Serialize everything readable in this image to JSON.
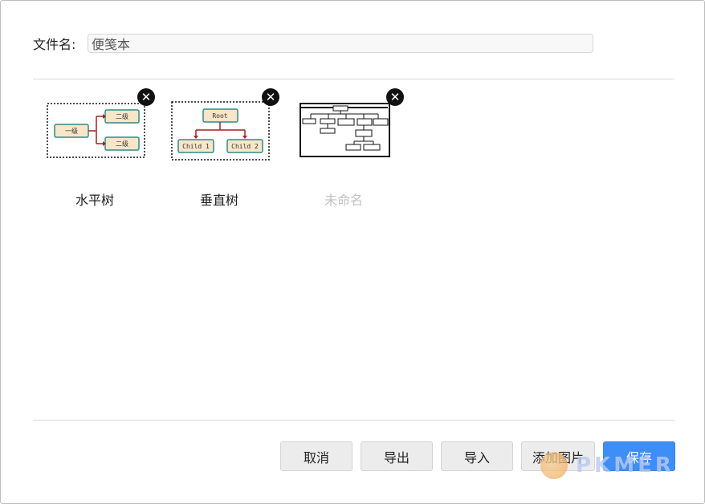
{
  "file": {
    "label": "文件名:",
    "value": "便笺本"
  },
  "templates": [
    {
      "label": "水平树",
      "thumb": {
        "root": "一级",
        "child1": "二级",
        "child2": "二级"
      },
      "muted": false
    },
    {
      "label": "垂直树",
      "thumb": {
        "root": "Root",
        "child1": "Child 1",
        "child2": "Child 2"
      },
      "muted": false
    },
    {
      "label": "未命名",
      "muted": true
    }
  ],
  "close_icon_glyph": "✕",
  "buttons": {
    "cancel": "取消",
    "export": "导出",
    "import": "导入",
    "add_image": "添加图片",
    "save": "保存"
  },
  "watermark": {
    "text": "PKMER"
  },
  "colors": {
    "node_fill": "#f9e6c8",
    "node_border": "#2f8b88",
    "connector": "#a12020",
    "primary": "#3e8ef7"
  }
}
